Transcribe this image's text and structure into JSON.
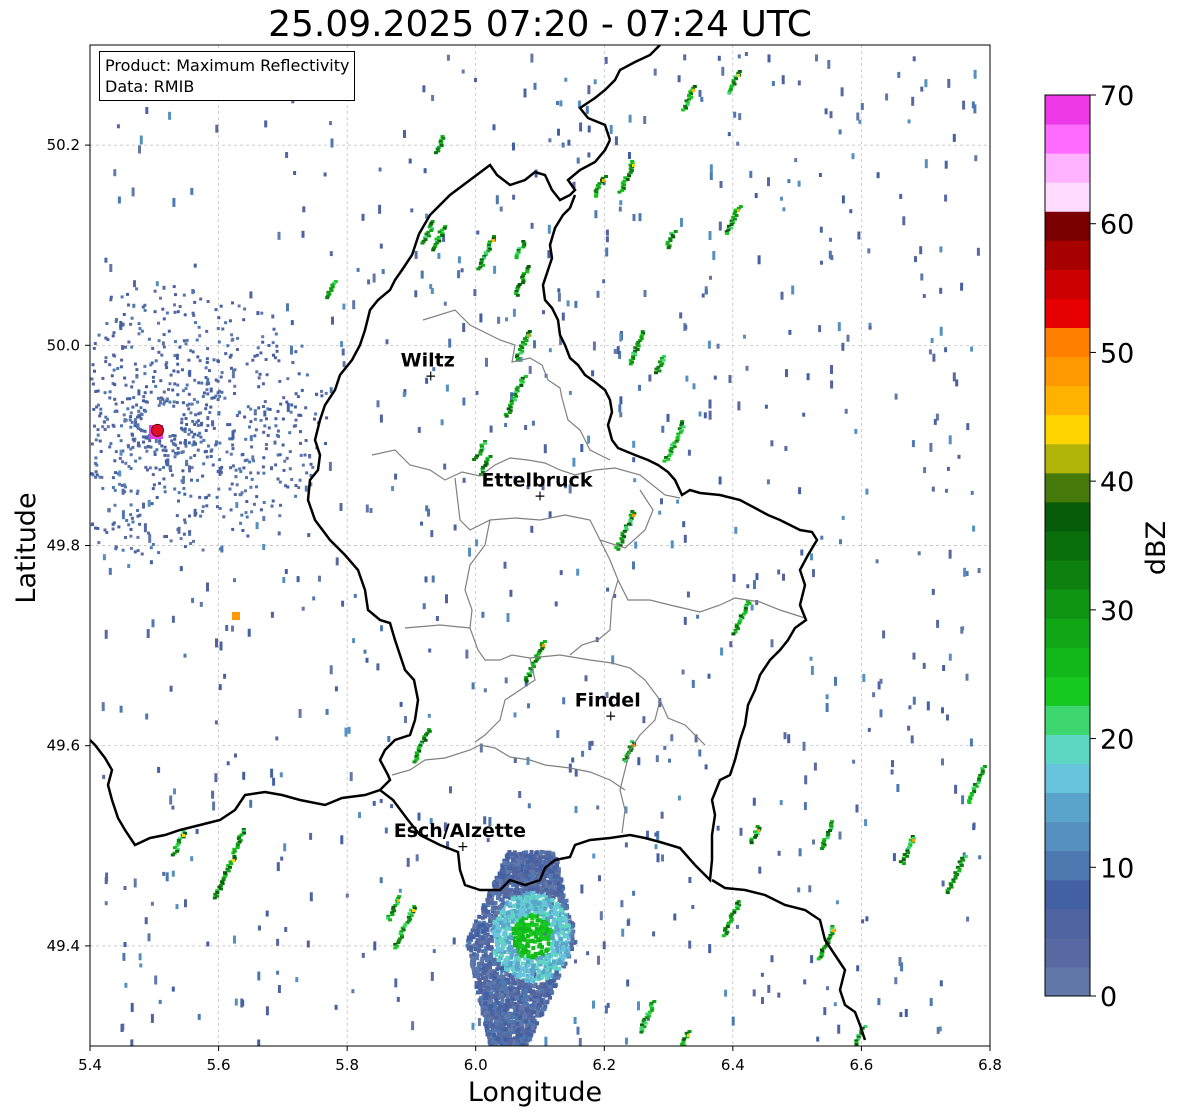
{
  "title": "25.09.2025 07:20 - 07:24 UTC",
  "info": {
    "product_line": "Product: Maximum Reflectivity",
    "data_line": "Data: RMIB"
  },
  "axes": {
    "xlabel": "Longitude",
    "ylabel": "Latitude",
    "xlim": [
      5.4,
      6.8
    ],
    "ylim": [
      49.3,
      50.3
    ],
    "xticks": [
      "5.4",
      "5.6",
      "5.8",
      "6.0",
      "6.2",
      "6.4",
      "6.6",
      "6.8"
    ],
    "yticks": [
      "49.4",
      "49.6",
      "49.8",
      "50.0",
      "50.2"
    ]
  },
  "cities": [
    {
      "name": "Wiltz",
      "lon": 5.93,
      "lat": 49.97
    },
    {
      "name": "Ettelbruck",
      "lon": 6.1,
      "lat": 49.85
    },
    {
      "name": "Findel",
      "lon": 6.21,
      "lat": 49.63
    },
    {
      "name": "Esch/Alzette",
      "lon": 5.98,
      "lat": 49.5
    }
  ],
  "radar_site": {
    "lon": 5.505,
    "lat": 49.915
  },
  "colorbar": {
    "label": "dBZ",
    "ticks": [
      "0",
      "10",
      "20",
      "30",
      "40",
      "50",
      "60",
      "70"
    ],
    "min": 0,
    "max": 70,
    "step": 2.5,
    "colors": [
      "#6178a8",
      "#5869a1",
      "#4e63a0",
      "#4360a2",
      "#4d78b0",
      "#5590c0",
      "#5aa4cc",
      "#68c3dd",
      "#5dd6c2",
      "#3ed66e",
      "#16c820",
      "#12b81a",
      "#10a615",
      "#0f9312",
      "#0d8010",
      "#0a6e0d",
      "#065c09",
      "#457a0b",
      "#b1b309",
      "#ffd500",
      "#ffb300",
      "#ff9900",
      "#ff7f00",
      "#e60000",
      "#cc0000",
      "#a60000",
      "#7a0000",
      "#ffdcff",
      "#ffb2ff",
      "#ff6aff",
      "#ec3ae9"
    ]
  }
}
